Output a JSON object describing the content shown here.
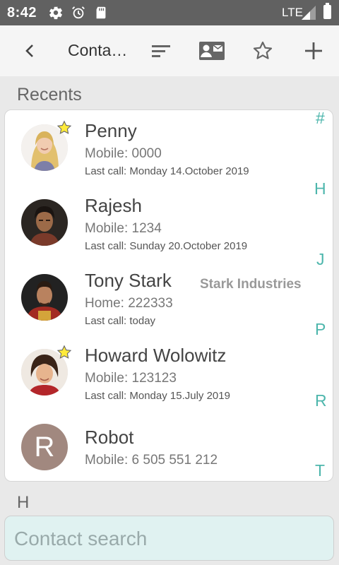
{
  "status": {
    "time": "8:42",
    "network": "LTE"
  },
  "app_bar": {
    "title": "Conta…"
  },
  "recents_header": "Recents",
  "contacts": [
    {
      "name": "Penny",
      "phone": "Mobile: 0000",
      "last_call": "Last call: Monday 14.October 2019",
      "starred": true
    },
    {
      "name": "Rajesh",
      "phone": "Mobile: 1234",
      "last_call": "Last call: Sunday 20.October 2019",
      "starred": false
    },
    {
      "name": "Tony Stark",
      "company": "Stark Industries",
      "phone": "Home: 222333",
      "last_call": "Last call: today",
      "starred": false
    },
    {
      "name": "Howard Wolowitz",
      "phone": "Mobile: 123123",
      "last_call": "Last call: Monday 15.July 2019",
      "starred": true
    },
    {
      "name": "Robot",
      "phone": "Mobile: 6 505 551 212",
      "avatar_letter": "R",
      "starred": false
    }
  ],
  "index_letters": [
    "#",
    "H",
    "J",
    "P",
    "R",
    "T"
  ],
  "group_header": "H",
  "search": {
    "placeholder": "Contact search"
  },
  "colors": {
    "accent": "#4db6ac",
    "search_bg": "#e0f2f1",
    "status_bar": "#616161",
    "star": "#ffeb3b",
    "letter_avatar": "#a1887f"
  }
}
